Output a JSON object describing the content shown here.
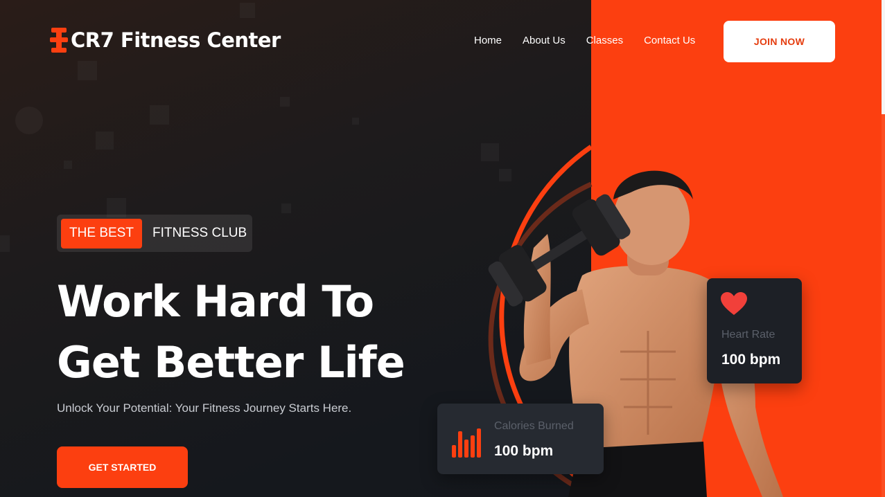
{
  "brand": {
    "name": "CR7 Fitness Center",
    "icon": "dumbbell-icon",
    "accent": "#fc3f10"
  },
  "nav": {
    "items": [
      {
        "label": "Home"
      },
      {
        "label": "About Us"
      },
      {
        "label": "Classes"
      },
      {
        "label": "Contact Us"
      }
    ],
    "join_label": "JOIN NOW"
  },
  "hero": {
    "tag_highlight": "THE BEST",
    "tag_text": "FITNESS CLUB",
    "headline_line1": "Work Hard To",
    "headline_line2": "Get Better Life",
    "subtitle": "Unlock Your Potential: Your Fitness Journey Starts Here.",
    "cta_label": "GET STARTED"
  },
  "stats": {
    "heart": {
      "icon": "heart-icon",
      "label": "Heart Rate",
      "value": "100 bpm"
    },
    "calories": {
      "icon": "bar-chart-icon",
      "label": "Calories Burned",
      "value": "100 bpm"
    }
  }
}
